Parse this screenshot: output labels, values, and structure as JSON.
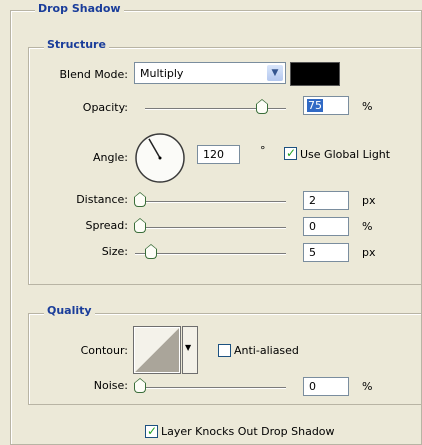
{
  "drop_shadow": {
    "title": "Drop Shadow",
    "structure": {
      "title": "Structure",
      "blend_mode": {
        "label": "Blend Mode:",
        "value": "Multiply",
        "color": "#000000"
      },
      "opacity": {
        "label": "Opacity:",
        "value": "75",
        "unit": "%",
        "slider_fraction": 0.75
      },
      "angle": {
        "label": "Angle:",
        "value": "120",
        "unit": "°",
        "degrees": 120
      },
      "use_global_light": {
        "label": "Use Global Light",
        "checked": true
      },
      "distance": {
        "label": "Distance:",
        "value": "2",
        "unit": "px",
        "slider_fraction": 0.0
      },
      "spread": {
        "label": "Spread:",
        "value": "0",
        "unit": "%",
        "slider_fraction": 0.0
      },
      "size": {
        "label": "Size:",
        "value": "5",
        "unit": "px",
        "slider_fraction": 0.02
      }
    },
    "quality": {
      "title": "Quality",
      "contour": {
        "label": "Contour:"
      },
      "anti_aliased": {
        "label": "Anti-aliased",
        "checked": false
      },
      "noise": {
        "label": "Noise:",
        "value": "0",
        "unit": "%",
        "slider_fraction": 0.0
      }
    },
    "layer_knocks_out": {
      "label": "Layer Knocks Out Drop Shadow",
      "checked": true
    }
  }
}
